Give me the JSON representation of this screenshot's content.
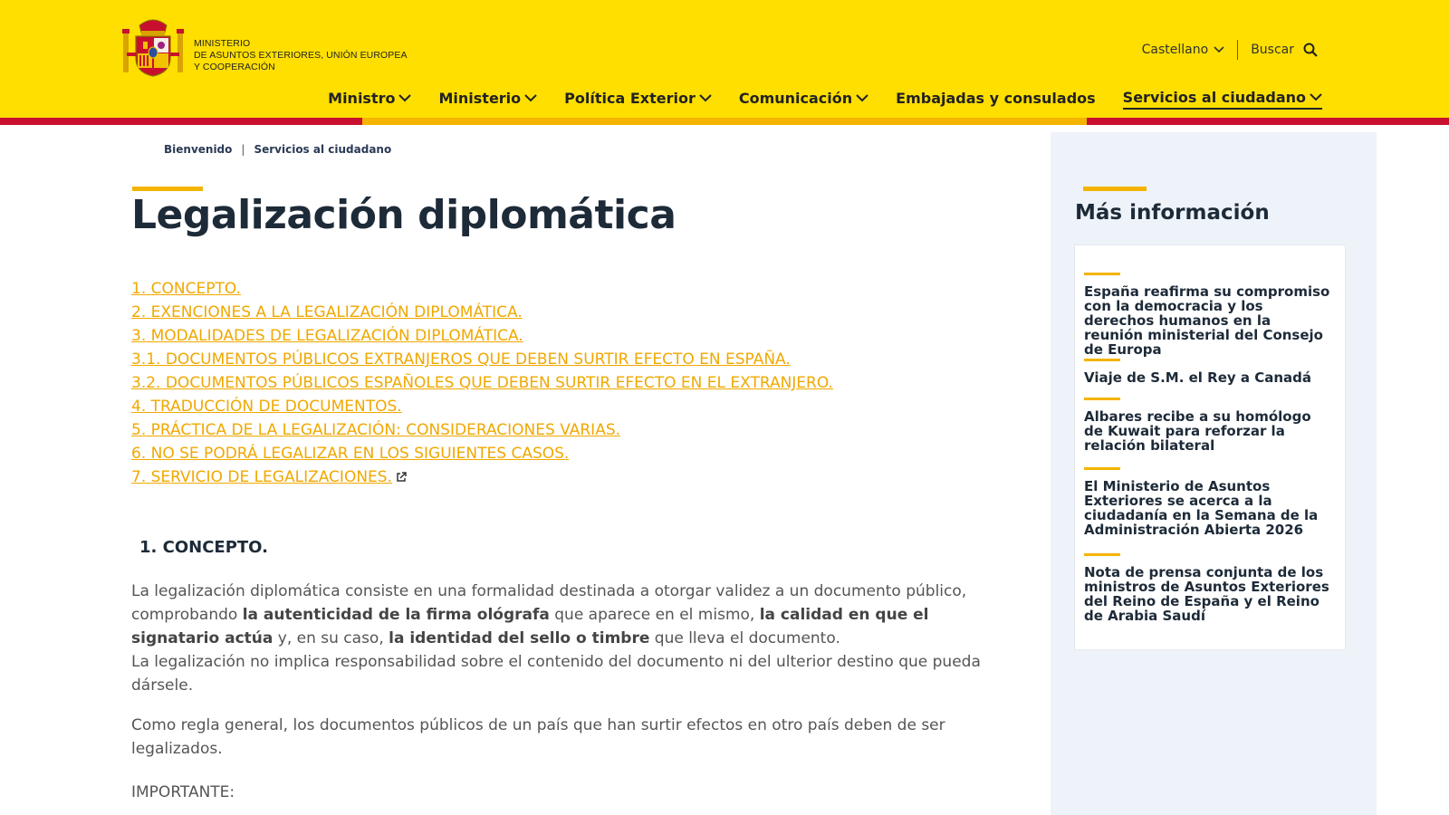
{
  "header": {
    "logo_lines": [
      "MINISTERIO",
      "DE ASUNTOS EXTERIORES, UNIÓN EUROPEA",
      "Y COOPERACIÓN"
    ],
    "language": "Castellano",
    "search_label": "Buscar",
    "nav": [
      {
        "label": "Ministro",
        "dropdown": true
      },
      {
        "label": "Ministerio",
        "dropdown": true
      },
      {
        "label": "Política Exterior",
        "dropdown": true
      },
      {
        "label": "Comunicación",
        "dropdown": true
      },
      {
        "label": "Embajadas y consulados",
        "dropdown": false
      },
      {
        "label": "Servicios al ciudadano",
        "dropdown": true,
        "active": true
      }
    ],
    "colors": {
      "background": "#ffdf00",
      "stripe_red": "#c8102e",
      "stripe_gold": "#f4b400"
    }
  },
  "breadcrumb": {
    "home": "Bienvenido",
    "separator": "|",
    "current": "Servicios al ciudadano"
  },
  "main": {
    "title": "Legalización diplomática",
    "toc": [
      "1. CONCEPTO.",
      "2. EXENCIONES A LA LEGALIZACIÓN DIPLOMÁTICA.",
      "3. MODALIDADES DE LEGALIZACIÓN DIPLOMÁTICA.",
      "3.1. DOCUMENTOS PÚBLICOS EXTRANJEROS QUE DEBEN SURTIR EFECTO EN ESPAÑA.",
      "3.2. DOCUMENTOS PÚBLICOS ESPAÑOLES QUE DEBEN SURTIR EFECTO EN EL EXTRANJERO.",
      "4. TRADUCCIÓN DE DOCUMENTOS.",
      "5. PRÁCTICA DE LA LEGALIZACIÓN: CONSIDERACIONES VARIAS.",
      "6. NO SE PODRÁ LEGALIZAR EN LOS SIGUIENTES CASOS.",
      "7. SERVICIO DE LEGALIZACIONES."
    ],
    "section_title": "1. CONCEPTO.",
    "p1_a": "La legalización diplomática consiste en una formalidad destinada a otorgar validez a un documento público, comprobando ",
    "p1_b": "la autenticidad de la firma ológrafa",
    "p1_c": " que aparece en el mismo, ",
    "p1_d": "la calidad en que el signatario actúa",
    "p1_e": " y, en su caso, ",
    "p1_f": "la identidad del sello o timbre",
    "p1_g": " que lleva el documento.",
    "p1_h": "La legalización no implica responsabilidad sobre el contenido del documento ni del ulterior destino que pueda dársele.",
    "p2": "Como regla general, los documentos públicos de un país que han surtir efectos en otro país deben de ser legalizados.",
    "p3": "IMPORTANTE:",
    "link_color": "#f0a800"
  },
  "sidebar": {
    "title": "Más información",
    "items": [
      "España reafirma su compromiso con la democracia y los derechos humanos en la reunión ministerial del Consejo de Europa",
      "Viaje de S.M. el Rey a Canadá",
      "Albares recibe a su homólogo de Kuwait para reforzar la relación bilateral",
      "El Ministerio de Asuntos Exteriores se acerca a la ciudadanía en la Semana de la Administración Abierta 2026",
      "Nota de prensa conjunta de los ministros de Asuntos Exteriores del Reino de España y el Reino de Arabia Saudí"
    ]
  }
}
